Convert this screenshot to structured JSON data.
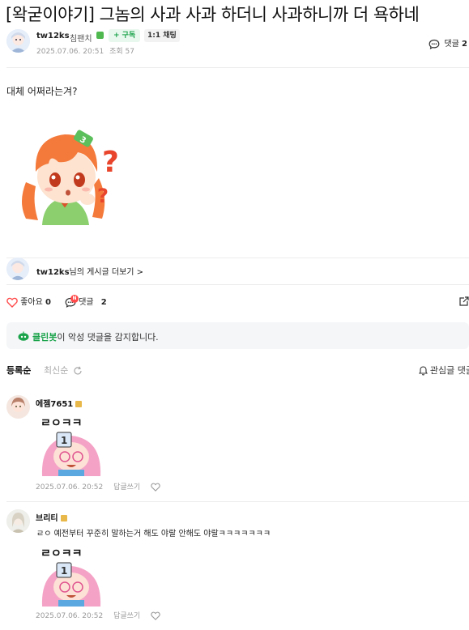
{
  "post": {
    "title": "[왁굳이야기] 그놈의 사과 사과 하더니 사과하니까 더 욕하네",
    "author": "tw12ks",
    "rank": "침팬치",
    "subscribe_label": "+ 구독",
    "chat_label": "1:1 채팅",
    "date": "2025.07.06. 20:51",
    "views": "조회 57",
    "comment_count_label": "댓글",
    "comment_count": "2",
    "body": "대체 어쩌라는겨?"
  },
  "more_posts": {
    "author": "tw12ks",
    "suffix": "님의 게시글 더보기 >"
  },
  "actions": {
    "like_label": "좋아요",
    "like_count": "0",
    "comment_label": "댓글",
    "comment_count": "2",
    "new_badge": "N"
  },
  "cleanbot": {
    "name": "클린봇",
    "message": "이 악성 댓글을 감지합니다."
  },
  "sort": {
    "active": "등록순",
    "latest": "최신순",
    "watch": "관심글 댓글"
  },
  "comments": [
    {
      "nick": "에젬7651",
      "sticker_text": "ㄹㅇㅋㅋ",
      "text": "",
      "date": "2025.07.06. 20:52",
      "reply": "답글쓰기"
    },
    {
      "nick": "브리티",
      "text": "ㄹㅇ 예전부터 꾸준히 말하는거 해도 야랄 안해도 야랄ㅋㅋㅋㅋㅋㅋㅋ",
      "sticker_text": "ㄹㅇㅋㅋ",
      "date": "2025.07.06. 20:52",
      "reply": "답글쓰기"
    }
  ],
  "colors": {
    "green": "#1aa34a",
    "red": "#ff4b4b",
    "muted": "#999999"
  }
}
